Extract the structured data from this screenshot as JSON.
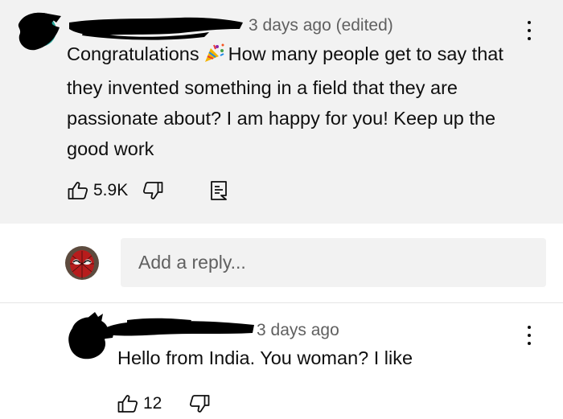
{
  "top_comment": {
    "author": "",
    "meta": "3 days ago (edited)",
    "text_before_emoji": "Congratulations",
    "emoji_icon": "party-popper-icon",
    "text_after_emoji": "How many people get to say that they invented something in a field that they are passionate about? I am happy for you! Keep up the good work",
    "likes": "5.9K",
    "icons": [
      "thumbs-up-icon",
      "thumbs-down-icon",
      "comment-reply-icon",
      "more-vertical-icon"
    ]
  },
  "reply_box": {
    "placeholder": "Add a reply..."
  },
  "reply_comment": {
    "author": "",
    "meta": "3 days ago",
    "text": "Hello from India. You woman? I like",
    "likes": "12",
    "icons": [
      "thumbs-up-icon",
      "thumbs-down-icon",
      "more-vertical-icon"
    ]
  }
}
